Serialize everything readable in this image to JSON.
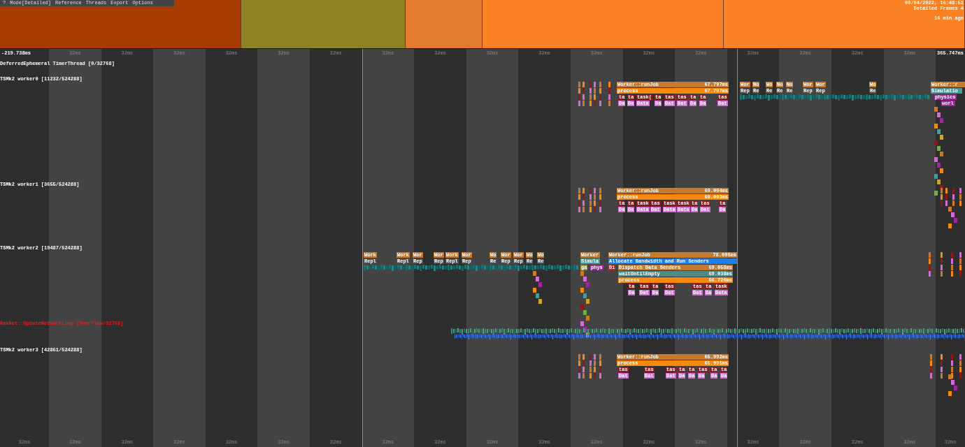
{
  "menu": [
    {
      "label": "?"
    },
    {
      "label": "Mode[Detailed]"
    },
    {
      "label": "Reference"
    },
    {
      "label": "Threads"
    },
    {
      "label": "Export"
    },
    {
      "label": "Options"
    }
  ],
  "info": [
    "09/04/2022, 16:48:51",
    "Detailed Frames 4",
    "16 min ago"
  ],
  "frames": [
    {
      "color": "#a83a02"
    },
    {
      "color": "#8e8222"
    },
    {
      "color": "#e27a30"
    },
    {
      "color": "#fb8224"
    },
    {
      "color": "#fb8224"
    }
  ],
  "ruler": {
    "start": "-219.738ms",
    "end": "365.747ms"
  },
  "columns": [
    {
      "bottom": "32ms"
    },
    {
      "top": "32ms",
      "bottom": "32ms"
    },
    {
      "top": "32ms",
      "bottom": "32ms"
    },
    {
      "top": "32ms",
      "bottom": "32ms"
    },
    {
      "top": "32ms",
      "bottom": "32ms"
    },
    {
      "top": "32ms",
      "bottom": "32ms"
    },
    {
      "top": "32ms",
      "bottom": "32ms"
    },
    {
      "top": "32ms",
      "bottom": "32ms"
    },
    {
      "top": "32ms",
      "bottom": "32ms"
    },
    {
      "top": "32ms",
      "bottom": "32ms"
    },
    {
      "top": "32ms",
      "bottom": "32ms"
    },
    {
      "top": "32ms",
      "bottom": "32ms"
    },
    {
      "top": "32ms",
      "bottom": "32ms"
    },
    {
      "top": "32ms",
      "bottom": "32ms"
    },
    {
      "top": "32ms",
      "bottom": "32ms"
    },
    {
      "top": "32ms",
      "bottom": "32ms"
    },
    {
      "top": "32ms",
      "bottom": "32ms"
    },
    {
      "top": "32ms",
      "bottom": "32ms"
    },
    {
      "bottom": "32ms"
    }
  ],
  "threads": [
    {
      "name": "DeferredEphemeral TimerThread [0/32768]",
      "color": "#ffffff"
    },
    {
      "name": "TSMk2 worker0 [11232/524288]",
      "color": "#ffffff",
      "spans": [
        {
          "text": "Worker::runJob",
          "duration": "67.797ms",
          "color": "#c67a2e"
        },
        {
          "text": "process",
          "duration": "67.797ms",
          "color": "#f7890f"
        },
        {
          "text": "ta",
          "color": "#8b1a1a"
        },
        {
          "text": "ta",
          "color": "#8b1a1a"
        },
        {
          "text": "task(",
          "color": "#8b1a1a"
        },
        {
          "text": "ta",
          "color": "#8b1a1a"
        },
        {
          "text": "tas",
          "color": "#8b1a1a"
        },
        {
          "text": "tas",
          "color": "#8b1a1a"
        },
        {
          "text": "ta",
          "color": "#8b1a1a"
        },
        {
          "text": "ta",
          "color": "#8b1a1a"
        },
        {
          "text": "tas",
          "color": "#8b1a1a"
        },
        {
          "text": "Da",
          "color": "#cf6fd4"
        },
        {
          "text": "Da",
          "color": "#cf6fd4"
        },
        {
          "text": "Data",
          "color": "#cf6fd4"
        },
        {
          "text": "Da",
          "color": "#cf6fd4"
        },
        {
          "text": "Dat",
          "color": "#cf6fd4"
        },
        {
          "text": "Dat",
          "color": "#cf6fd4"
        },
        {
          "text": "Da",
          "color": "#cf6fd4"
        },
        {
          "text": "Da",
          "color": "#cf6fd4"
        },
        {
          "text": "Dat",
          "color": "#cf6fd4"
        },
        {
          "text": "Wor",
          "color": "#c67a2e"
        },
        {
          "text": "No",
          "color": "#c67a2e"
        },
        {
          "text": "Wo",
          "color": "#c67a2e"
        },
        {
          "text": "No",
          "color": "#c67a2e"
        },
        {
          "text": "No",
          "color": "#c67a2e"
        },
        {
          "text": "Wor",
          "color": "#c67a2e"
        },
        {
          "text": "Wor",
          "color": "#c67a2e"
        },
        {
          "text": "Wo",
          "color": "#c67a2e"
        },
        {
          "text": "Worker::r",
          "color": "#c67a2e"
        },
        {
          "text": "Rep",
          "color": "#4c4c4c"
        },
        {
          "text": "Re",
          "color": "#4c4c4c"
        },
        {
          "text": "Re",
          "color": "#4c4c4c"
        },
        {
          "text": "Re",
          "color": "#4c4c4c"
        },
        {
          "text": "Re",
          "color": "#4c4c4c"
        },
        {
          "text": "Rep",
          "color": "#4c4c4c"
        },
        {
          "text": "Rep",
          "color": "#4c4c4c"
        },
        {
          "text": "Re",
          "color": "#4c4c4c"
        },
        {
          "text": "Simulatio",
          "color": "#4a9a9a"
        },
        {
          "text": "physics",
          "color": "#9a2a9a"
        },
        {
          "text": "worl",
          "color": "#9a2a9a"
        }
      ]
    },
    {
      "name": "TSMk2 worker1 [3655/524288]",
      "color": "#ffffff",
      "spans": [
        {
          "text": "Worker::runJob",
          "duration": "69.004ms",
          "color": "#c67a2e"
        },
        {
          "text": "process",
          "duration": "69.003ms",
          "color": "#f7890f"
        },
        {
          "text": "ta",
          "color": "#8b1a1a"
        },
        {
          "text": "ta",
          "color": "#8b1a1a"
        },
        {
          "text": "task",
          "color": "#8b1a1a"
        },
        {
          "text": "tas",
          "color": "#8b1a1a"
        },
        {
          "text": "task",
          "color": "#8b1a1a"
        },
        {
          "text": "task",
          "color": "#8b1a1a"
        },
        {
          "text": "ta",
          "color": "#8b1a1a"
        },
        {
          "text": "tas",
          "color": "#8b1a1a"
        },
        {
          "text": "ta",
          "color": "#8b1a1a"
        },
        {
          "text": "Da",
          "color": "#cf6fd4"
        },
        {
          "text": "Da",
          "color": "#cf6fd4"
        },
        {
          "text": "Data",
          "color": "#cf6fd4"
        },
        {
          "text": "Dat",
          "color": "#cf6fd4"
        },
        {
          "text": "Data",
          "color": "#cf6fd4"
        },
        {
          "text": "Data",
          "color": "#cf6fd4"
        },
        {
          "text": "Da",
          "color": "#cf6fd4"
        },
        {
          "text": "Dat",
          "color": "#cf6fd4"
        },
        {
          "text": "Da",
          "color": "#cf6fd4"
        }
      ]
    },
    {
      "name": "TSMk2 worker2 [19487/524288]",
      "color": "#ffffff",
      "spans": [
        {
          "text": "Work",
          "color": "#c67a2e"
        },
        {
          "text": "Work",
          "color": "#c67a2e"
        },
        {
          "text": "Wor",
          "color": "#c67a2e"
        },
        {
          "text": "Wor",
          "color": "#c67a2e"
        },
        {
          "text": "Work",
          "color": "#c67a2e"
        },
        {
          "text": "Wor",
          "color": "#c67a2e"
        },
        {
          "text": "Wo",
          "color": "#c67a2e"
        },
        {
          "text": "Wor",
          "color": "#c67a2e"
        },
        {
          "text": "Wor",
          "color": "#c67a2e"
        },
        {
          "text": "Wo",
          "color": "#c67a2e"
        },
        {
          "text": "Wo",
          "color": "#c67a2e"
        },
        {
          "text": "Worker",
          "color": "#c67a2e"
        },
        {
          "text": "Worker::runJob",
          "duration": "78.096ms",
          "color": "#c67a2e"
        },
        {
          "text": "Repl",
          "color": "#4c4c4c"
        },
        {
          "text": "Repl",
          "color": "#4c4c4c"
        },
        {
          "text": "Rep",
          "color": "#4c4c4c"
        },
        {
          "text": "Rep",
          "color": "#4c4c4c"
        },
        {
          "text": "Repl",
          "color": "#4c4c4c"
        },
        {
          "text": "Rep",
          "color": "#4c4c4c"
        },
        {
          "text": "Re",
          "color": "#4c4c4c"
        },
        {
          "text": "Rep",
          "color": "#4c4c4c"
        },
        {
          "text": "Rep",
          "color": "#4c4c4c"
        },
        {
          "text": "Re",
          "color": "#4c4c4c"
        },
        {
          "text": "Re",
          "color": "#4c4c4c"
        },
        {
          "text": "Simula",
          "color": "#4a9a9a"
        },
        {
          "text": "Allocate Bandwidth and Run Senders",
          "color": "#1f7fe8"
        },
        {
          "text": "ga",
          "color": "#9a9430"
        },
        {
          "text": "phys",
          "color": "#9a2a9a"
        },
        {
          "text": "Di",
          "color": "#c0202c"
        },
        {
          "text": "Dispatch Data Senders",
          "duration": "69.058ms",
          "color": "#c67a2e"
        },
        {
          "text": "waitUntilEmpty",
          "duration": "69.038ms",
          "color": "#4e8a86"
        },
        {
          "text": "process",
          "duration": "66.726ms",
          "color": "#f7890f"
        },
        {
          "text": "ta",
          "color": "#8b1a1a"
        },
        {
          "text": "tas",
          "color": "#8b1a1a"
        },
        {
          "text": "ta",
          "color": "#8b1a1a"
        },
        {
          "text": "tas",
          "color": "#8b1a1a"
        },
        {
          "text": "tas",
          "color": "#8b1a1a"
        },
        {
          "text": "ta",
          "color": "#8b1a1a"
        },
        {
          "text": "task",
          "color": "#8b1a1a"
        },
        {
          "text": "Da",
          "color": "#cf6fd4"
        },
        {
          "text": "Dat",
          "color": "#cf6fd4"
        },
        {
          "text": "Da",
          "color": "#cf6fd4"
        },
        {
          "text": "Dat",
          "color": "#cf6fd4"
        },
        {
          "text": "Dat",
          "color": "#cf6fd4"
        },
        {
          "text": "Da",
          "color": "#cf6fd4"
        },
        {
          "text": "Data",
          "color": "#cf6fd4"
        }
      ]
    },
    {
      "name": "RakNet::UpdateNetworkLoop [Overflow/32768]",
      "color": "#e02020"
    },
    {
      "name": "TSMk2 worker3 [42861/524288]",
      "color": "#ffffff",
      "spans": [
        {
          "text": "Worker::runJob",
          "duration": "65.992ms",
          "color": "#c67a2e"
        },
        {
          "text": "process",
          "duration": "65.991ms",
          "color": "#f7890f"
        },
        {
          "text": "tas",
          "color": "#8b1a1a"
        },
        {
          "text": "tas",
          "color": "#8b1a1a"
        },
        {
          "text": "tas",
          "color": "#8b1a1a"
        },
        {
          "text": "ta",
          "color": "#8b1a1a"
        },
        {
          "text": "ta",
          "color": "#8b1a1a"
        },
        {
          "text": "tas",
          "color": "#8b1a1a"
        },
        {
          "text": "ta",
          "color": "#8b1a1a"
        },
        {
          "text": "ta",
          "color": "#8b1a1a"
        },
        {
          "text": "Dat",
          "color": "#cf6fd4"
        },
        {
          "text": "Dat",
          "color": "#cf6fd4"
        },
        {
          "text": "Dat",
          "color": "#cf6fd4"
        },
        {
          "text": "Da",
          "color": "#cf6fd4"
        },
        {
          "text": "Da",
          "color": "#cf6fd4"
        },
        {
          "text": "Da",
          "color": "#cf6fd4"
        },
        {
          "text": "Da",
          "color": "#cf6fd4"
        },
        {
          "text": "Da",
          "color": "#cf6fd4"
        }
      ]
    }
  ]
}
